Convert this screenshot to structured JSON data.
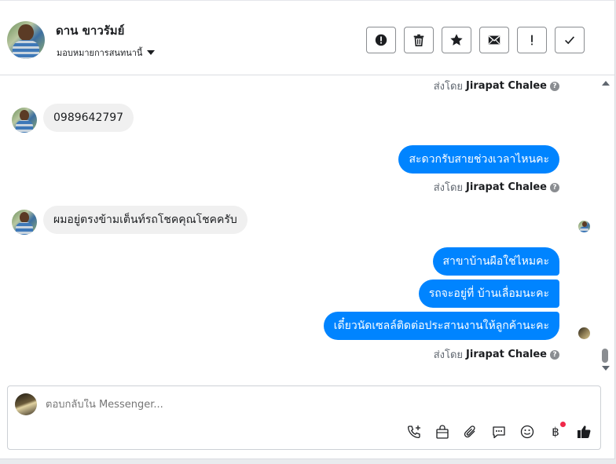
{
  "header": {
    "contact_name": "ดาน ขาวรัมย์",
    "assign_label": "มอบหมายการสนทนานี้",
    "toolbar": [
      {
        "name": "report-spam-button",
        "icon": "alert-circle-icon"
      },
      {
        "name": "delete-button",
        "icon": "trash-icon"
      },
      {
        "name": "star-button",
        "icon": "star-icon"
      },
      {
        "name": "mark-unread-button",
        "icon": "envelope-icon"
      },
      {
        "name": "follow-up-button",
        "icon": "exclamation-icon"
      },
      {
        "name": "mark-done-button",
        "icon": "checkmark-icon"
      }
    ]
  },
  "conversation": {
    "sent_by_prefix": "ส่งโดย",
    "sender_name": "Jirapat Chalee",
    "messages": [
      {
        "dir": "in",
        "text": "0989642797"
      },
      {
        "dir": "out",
        "text": "สะดวกรับสายช่วงเวลาไหนคะ"
      },
      {
        "dir": "in",
        "text": "ผมอยู่ตรงข้ามเต็นท์รถโชคคุณโชคครับ"
      },
      {
        "dir": "out",
        "text": "สาขาบ้านผือใช่ไหมคะ"
      },
      {
        "dir": "out",
        "text": "รถจะอยู่ที่ บ้านเลื่อมนะคะ"
      },
      {
        "dir": "out",
        "text": "เดี๋ยวนัดเซลล์ติดต่อประสานงานให้ลูกค้านะคะ"
      }
    ]
  },
  "composer": {
    "placeholder": "ตอบกลับใน Messenger...",
    "icons": [
      "phone-add-icon",
      "shopping-bag-icon",
      "paperclip-icon",
      "chat-bubble-icon",
      "emoji-icon",
      "baht-icon",
      "thumbs-up-icon"
    ],
    "notification_color": "#f02849"
  },
  "colors": {
    "accent": "#0084ff",
    "incoming_bubble": "#f0f0f0"
  }
}
